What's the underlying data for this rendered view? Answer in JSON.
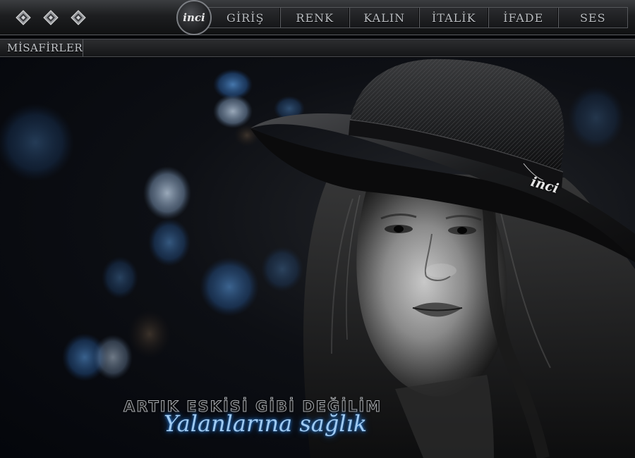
{
  "topbar": {
    "logo_text": "inci",
    "menu": [
      {
        "label": "GİRİŞ"
      },
      {
        "label": "RENK"
      },
      {
        "label": "KALIN"
      },
      {
        "label": "İTALİK"
      },
      {
        "label": "İFADE"
      },
      {
        "label": "SES"
      }
    ]
  },
  "subbar": {
    "label": "MİSAFİRLER"
  },
  "hero": {
    "title": "ARTIK ESKİSİ GİBİ DEĞİLİM",
    "subtitle": "Yalanlarına sağlık",
    "watermark": "inci"
  },
  "colors": {
    "subtitle_glow": "#2a7ed6",
    "bokeh_blue": "#3d7fd0"
  },
  "icons": [
    "diamond-icon",
    "diamond-icon",
    "diamond-icon"
  ]
}
